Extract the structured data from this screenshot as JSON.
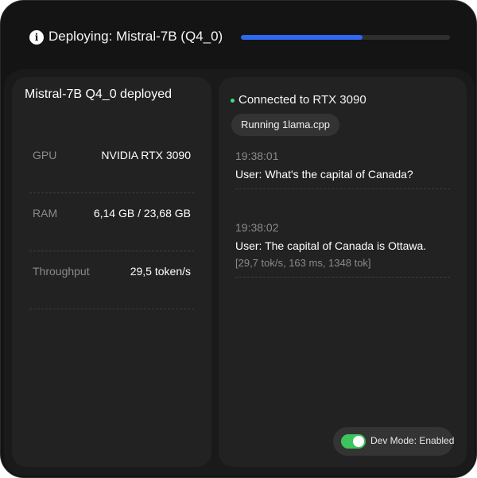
{
  "header": {
    "info_icon": "info-circle-icon",
    "title": "Deploying: Mistral-7B (Q4_0)",
    "progress": 0.58,
    "progress_color": "#2d68f0"
  },
  "summary": {
    "model_title": "Mistral-7B Q4_0 deployed",
    "stats": [
      {
        "label": "GPU",
        "value": "NVIDIA RTX 3090"
      },
      {
        "label": "RAM",
        "value": "6,14 GB / 23,68 GB"
      },
      {
        "label": "Throughput",
        "value": "29,5 token/s"
      }
    ]
  },
  "session": {
    "status_color": "#3ddc84",
    "connection": "Connected to RTX 3090",
    "runtime": "Running 1lama.cpp",
    "logs": [
      {
        "time": "19:38:01",
        "text": "User: What's the capital of Canada?",
        "meta": ""
      },
      {
        "time": "19:38:02",
        "text": "User: The capital of Canada is Ottawa.",
        "meta": "[29,7 tok/s, 163 ms, 1348 tok]"
      }
    ]
  },
  "dev_mode": {
    "label": "Dev Mode: Enabled",
    "enabled": true,
    "toggle_color": "#3ec45e"
  }
}
